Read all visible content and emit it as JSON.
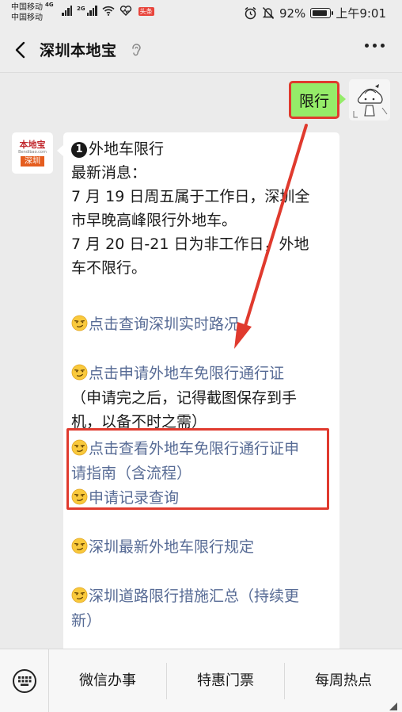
{
  "status_bar": {
    "carrier_1": "中国移动",
    "carrier_1_net": "4G",
    "carrier_2": "中国移动",
    "signal_2_label": "2G",
    "app_badge": "头条",
    "battery": "92%",
    "battery_level": 0.92,
    "time": "上午9:01"
  },
  "nav": {
    "title": "深圳本地宝"
  },
  "chat": {
    "user_message": "限行",
    "bot_logo": {
      "main": "本地宝",
      "sub": "Bendibao.com",
      "city": "深圳"
    },
    "bot_message": {
      "number": "1",
      "heading": "外地车限行",
      "lines": [
        "最新消息：",
        "7 月 19 日周五属于工作日，深圳全",
        "市早晚高峰限行外地车。",
        "7 月 20 日-21 日为非工作日，外地",
        "车不限行。"
      ],
      "links": [
        {
          "lines": [
            "点击查询深圳实时路况"
          ]
        },
        {
          "lines": [
            "点击申请外地车免限行通行证"
          ]
        },
        {
          "lines": [
            "点击查看外地车免限行通行证申",
            "请指南（含流程）"
          ]
        },
        {
          "lines": [
            "申请记录查询"
          ]
        },
        {
          "lines": [
            "深圳最新外地车限行规定"
          ]
        },
        {
          "lines": [
            "深圳道路限行措施汇总（持续更",
            "新）"
          ]
        }
      ],
      "note_lines": [
        "（申请完之后，记得截图保存到手",
        "机，以备不时之需）"
      ]
    },
    "colors": {
      "user_bubble": "#95ec69",
      "link": "#576b95",
      "annotation": "#e03a2e"
    }
  },
  "bottom_menu": {
    "items": [
      "微信办事",
      "特惠门票",
      "每周热点"
    ]
  }
}
